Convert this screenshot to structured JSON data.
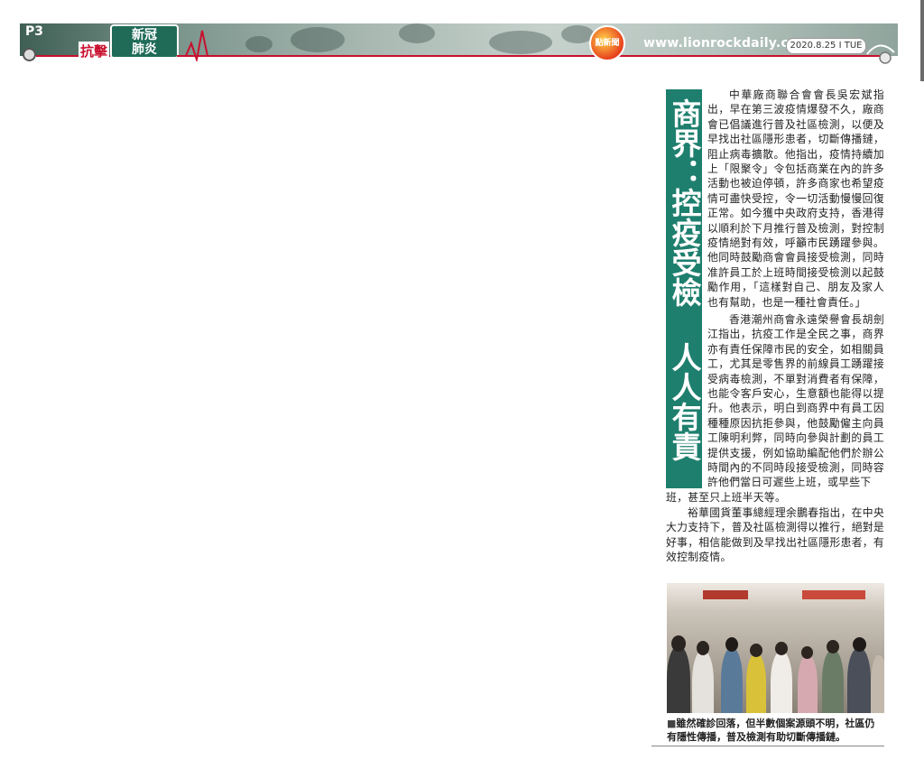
{
  "header": {
    "page_number": "P3",
    "section_red": "抗擊",
    "section_badge_line1": "新冠",
    "section_badge_line2": "肺炎",
    "site_url": "www.lionrockdaily.com",
    "date": "2020.8.25 I TUE",
    "logo_text": "點新聞",
    "colors": {
      "banner": "#7b958c",
      "accent_red": "#c8102e",
      "badge": "#1f6b58"
    }
  },
  "article": {
    "headline": "商界：控疫受檢 人人有責",
    "headline_bg": "#1e7f6e",
    "paragraphs": [
      "中華廠商聯合會會長吳宏斌指出，早在第三波疫情爆發不久，廠商會已倡議進行普及社區檢測，以便及早找出社區隱形患者，切斷傳播鏈，阻止病毒擴散。他指出，疫情持續加上「限聚令」令包括商業在內的許多活動也被迫停頓，許多商家也希望疫情可盡快受控，令一切活動慢慢回復正常。如今獲中央政府支持，香港得以順利於下月推行普及檢測，對控制疫情絕對有效，呼籲市民踴躍參與。他同時鼓勵商會會員接受檢測，同時准許員工於上班時間接受檢測以起鼓勵作用，「這樣對自己、朋友及家人也有幫助，也是一種社會責任。」",
      "香港潮州商會永遠榮譽會長胡劍江指出，抗疫工作是全民之事，商界亦有責任保障市民的安全，如相關員工，尤其是零售界的前線員工踴躍接受病毒檢測，不單對消費者有保障，也能令客戶安心，生意額也能得以提升。他表示，明白到商界中有員工因種種原因抗拒參與，他鼓勵僱主向員工陳明利弊，同時向參與計劃的員工提供支援，例如協助編配他們於辦公時間內的不同時段接受檢測，同時容許他們當日可遲些上班，或早些下",
      "班，甚至只上班半天等。",
      "裕華國貨董事總經理余鵬春指出，在中央大力支持下，普及社區檢測得以推行，絕對是好事，相信能做到及早找出社區隱形患者，有效控制疫情。"
    ]
  },
  "photo": {
    "caption_marker": "■",
    "caption": "雖然確診回落，但半數個案源頭不明，社區仍有隱性傳播，普及檢測有助切斷傳播鏈。"
  }
}
